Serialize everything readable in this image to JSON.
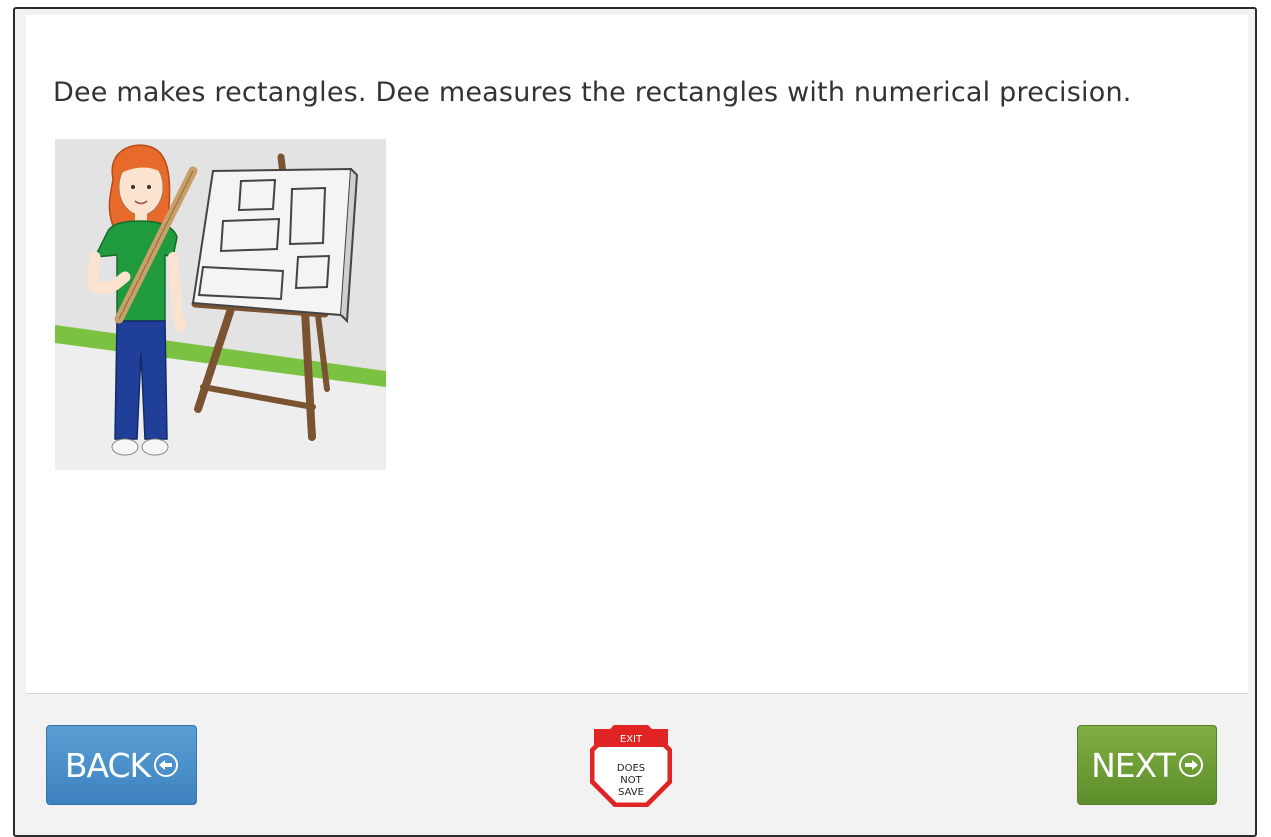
{
  "main": {
    "sentence": "Dee makes rectangles. Dee measures the rectangles with numerical precision.",
    "illustration_icon": "girl-holding-ruler-next-to-easel-with-rectangles"
  },
  "footer": {
    "back_label": "BACK",
    "back_icon": "arrow-left-circle-icon",
    "next_label": "NEXT",
    "next_icon": "arrow-right-circle-icon",
    "exit": {
      "top_label": "EXIT",
      "line1": "DOES",
      "line2": "NOT",
      "line3": "SAVE"
    }
  },
  "colors": {
    "back_button": "#4a90c9",
    "next_button": "#6f9e36",
    "exit_red": "#e02424",
    "wall_stripe": "#7cc242",
    "shirt": "#1f9a3f",
    "pants": "#1f3f99",
    "hair": "#e86a2a"
  }
}
